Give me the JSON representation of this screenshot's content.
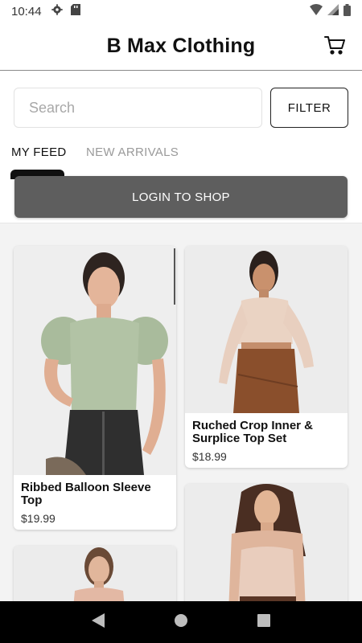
{
  "status_bar": {
    "time": "10:44",
    "icons": [
      "settings-icon",
      "sd-card-icon",
      "wifi-icon",
      "signal-icon",
      "battery-icon"
    ]
  },
  "header": {
    "title": "B Max Clothing",
    "cart_icon": "cart-icon"
  },
  "search": {
    "placeholder": "Search",
    "value": ""
  },
  "filter": {
    "label": "FILTER"
  },
  "tabs": [
    {
      "label": "MY FEED",
      "active": true
    },
    {
      "label": "NEW ARRIVALS",
      "active": false
    }
  ],
  "login": {
    "label": "LOGIN TO SHOP"
  },
  "products": [
    {
      "title": "Ribbed Balloon Sleeve Top",
      "price": "$19.99"
    },
    {
      "title": "Ruched Crop Inner & Surplice Top Set",
      "price": "$18.99"
    },
    {
      "title": "",
      "price": ""
    },
    {
      "title": "",
      "price": ""
    }
  ],
  "nav": {
    "icons": [
      "back-icon",
      "home-icon",
      "recents-icon"
    ]
  },
  "colors": {
    "login_button": "#5e5e5e",
    "accent": "#111111",
    "feed_background": "#f3f3f3",
    "inactive_tab": "#9a9a9a"
  }
}
